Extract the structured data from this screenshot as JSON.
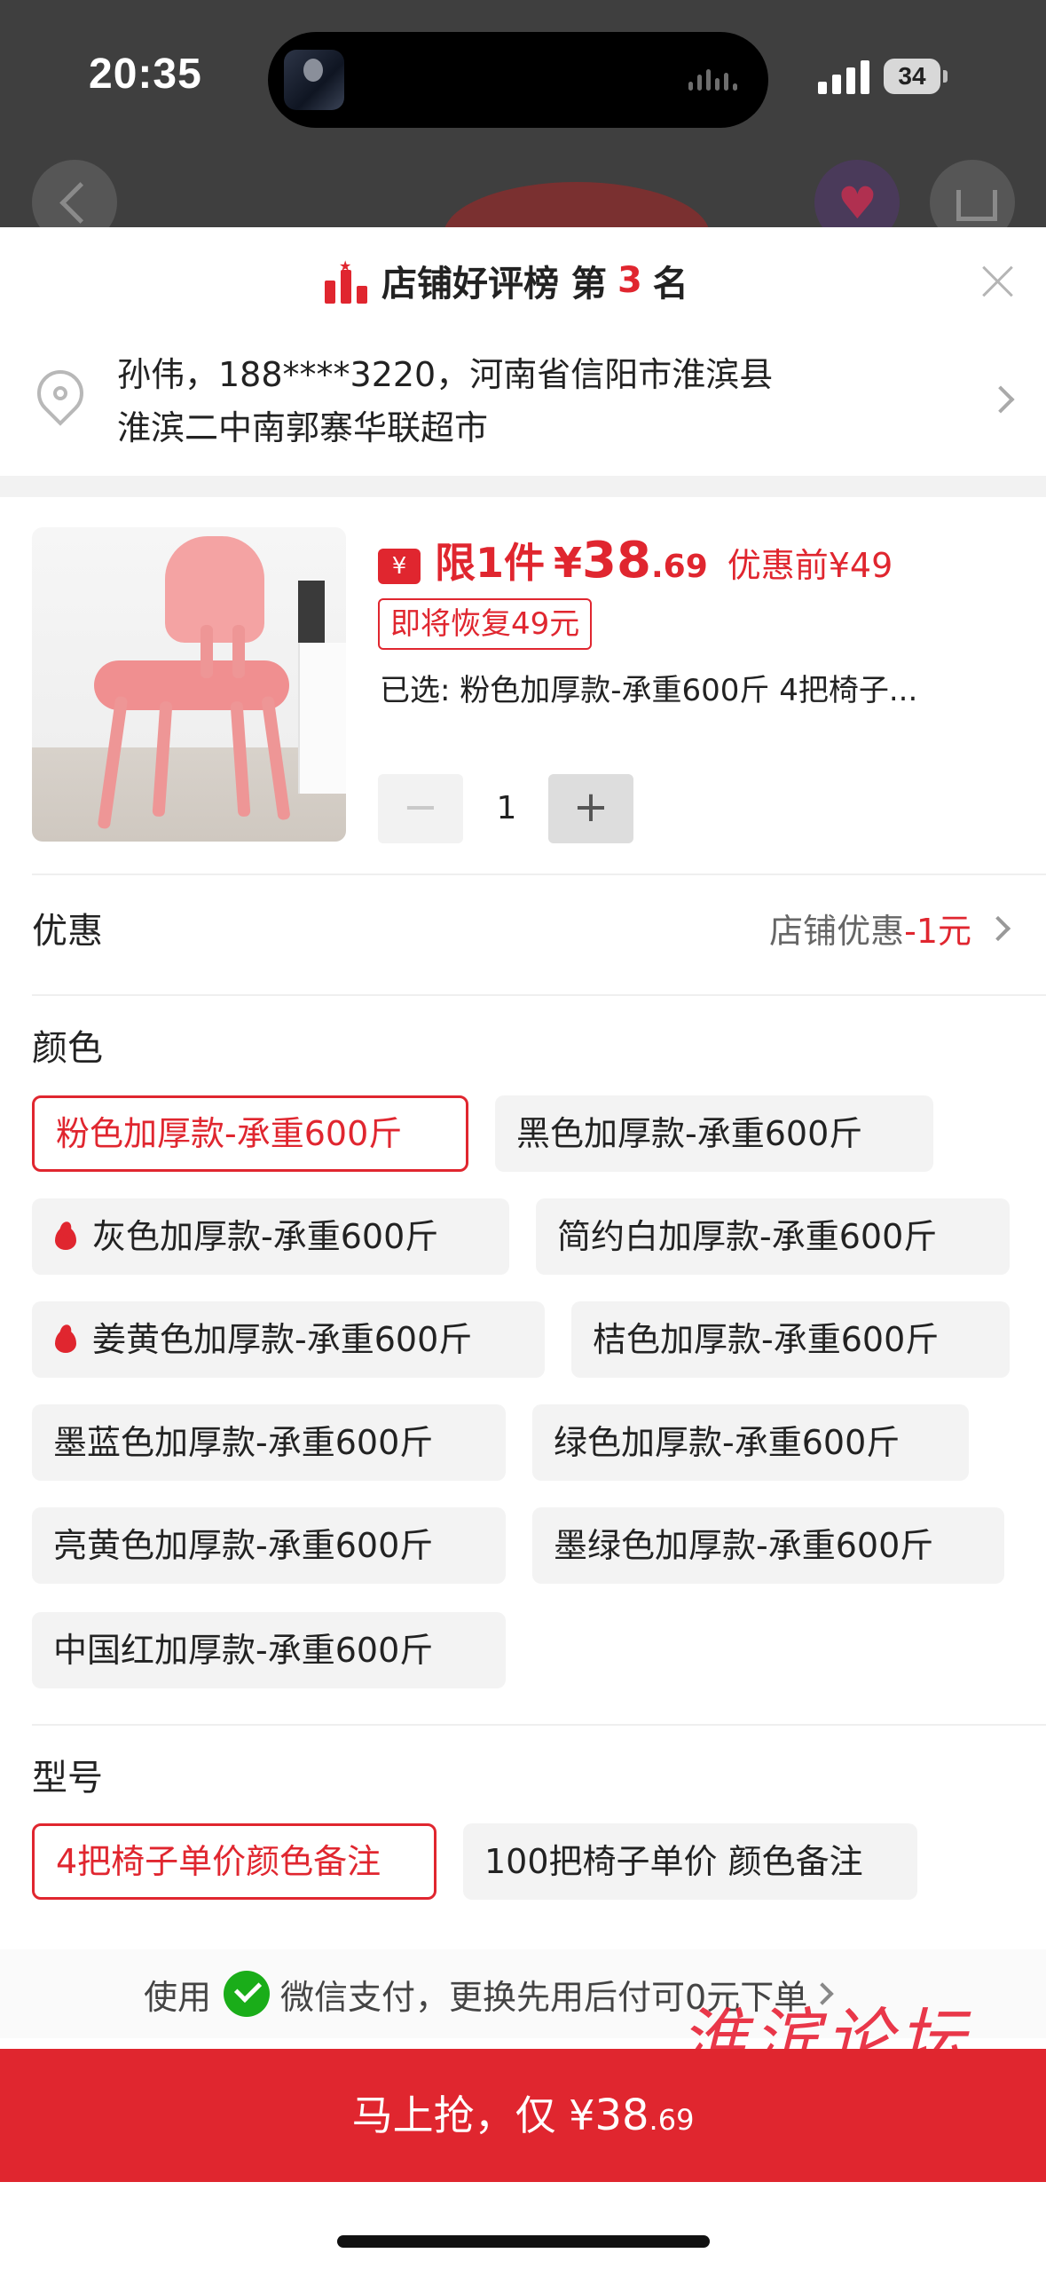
{
  "status_bar": {
    "time": "20:35",
    "battery": "34"
  },
  "rank": {
    "prefix": "店铺好评榜 第",
    "number": "3",
    "suffix": "名"
  },
  "address": {
    "line1": "孙伟，188****3220，河南省信阳市淮滨县",
    "line2": "淮滨二中南郭寨华联超市"
  },
  "product": {
    "coupon_symbol": "¥",
    "limit_text": "限1件",
    "price_symbol": "¥",
    "price_int": "38",
    "price_dec": ".69",
    "original_price": "优惠前¥49",
    "restore_tag": "即将恢复49元",
    "selected": "已选: 粉色加厚款-承重600斤 4把椅子..."
  },
  "stepper": {
    "minus": "−",
    "quantity": "1",
    "plus": "+"
  },
  "discount": {
    "label": "优惠",
    "value_prefix": "店铺优惠",
    "amount": "-1元"
  },
  "color_section": {
    "title": "颜色",
    "options": [
      {
        "label": "粉色加厚款-承重600斤",
        "selected": true,
        "hot": false
      },
      {
        "label": "黑色加厚款-承重600斤",
        "selected": false,
        "hot": false
      },
      {
        "label": "灰色加厚款-承重600斤",
        "selected": false,
        "hot": true
      },
      {
        "label": "简约白加厚款-承重600斤",
        "selected": false,
        "hot": false
      },
      {
        "label": "姜黄色加厚款-承重600斤",
        "selected": false,
        "hot": true
      },
      {
        "label": "桔色加厚款-承重600斤",
        "selected": false,
        "hot": false
      },
      {
        "label": "墨蓝色加厚款-承重600斤",
        "selected": false,
        "hot": false
      },
      {
        "label": "绿色加厚款-承重600斤",
        "selected": false,
        "hot": false
      },
      {
        "label": "亮黄色加厚款-承重600斤",
        "selected": false,
        "hot": false
      },
      {
        "label": "墨绿色加厚款-承重600斤",
        "selected": false,
        "hot": false
      },
      {
        "label": "中国红加厚款-承重600斤",
        "selected": false,
        "hot": false
      }
    ]
  },
  "model_section": {
    "title": "型号",
    "options": [
      {
        "label": "4把椅子单价颜色备注",
        "selected": true
      },
      {
        "label": "100把椅子单价 颜色备注",
        "selected": false
      }
    ]
  },
  "payment_tip": {
    "prefix": "使用",
    "text": "微信支付，更换先用后付可0元下单"
  },
  "watermark": "淮滨论坛",
  "buy_button": {
    "prefix": "马上抢，仅 ¥",
    "price_int": "38",
    "price_dec": ".69"
  },
  "colors": {
    "accent": "#e0262f",
    "wechat": "#1aad19"
  }
}
